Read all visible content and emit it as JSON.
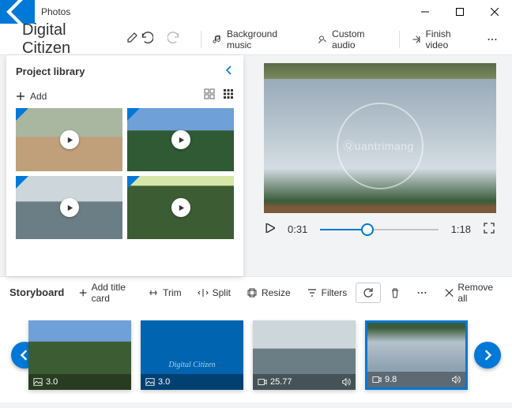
{
  "titlebar": {
    "app_name": "Photos"
  },
  "toolbar": {
    "project_name": "Digital Citizen",
    "bg_music": "Background music",
    "custom_audio": "Custom audio",
    "finish": "Finish video"
  },
  "library": {
    "title": "Project library",
    "add_label": "Add"
  },
  "player": {
    "current_time": "0:31",
    "total_time": "1:18"
  },
  "storyboard": {
    "title": "Storyboard",
    "add_title_card": "Add title card",
    "trim": "Trim",
    "split": "Split",
    "resize": "Resize",
    "filters": "Filters",
    "remove_all": "Remove all"
  },
  "clips": [
    {
      "duration": "3.0"
    },
    {
      "duration": "3.0",
      "caption": "Digital Citizen"
    },
    {
      "duration": "25.77"
    },
    {
      "duration": "9.8"
    }
  ],
  "watermark": "uantrimang"
}
